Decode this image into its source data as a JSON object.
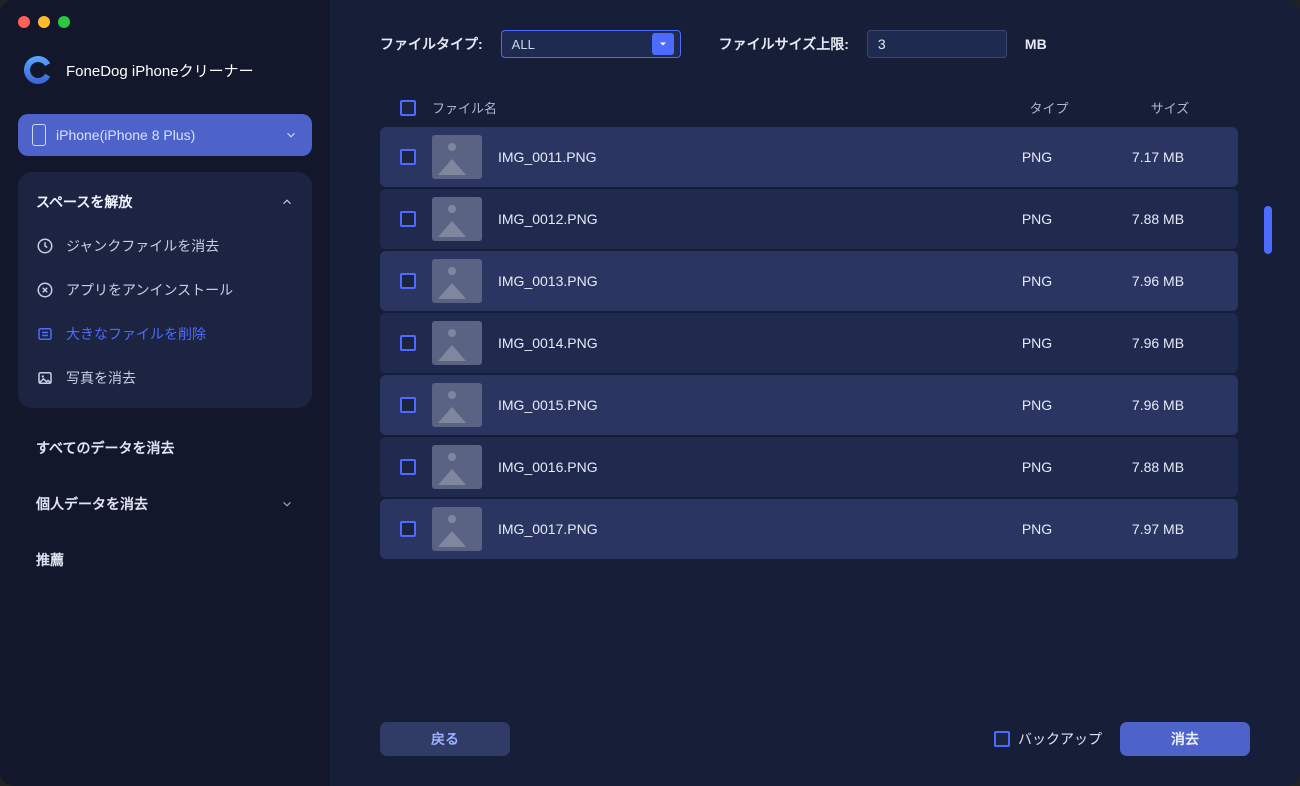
{
  "app_title": "FoneDog iPhoneクリーナー",
  "device": {
    "label": "iPhone(iPhone 8 Plus)"
  },
  "sidebar": {
    "free_space_header": "スペースを解放",
    "items": [
      {
        "label": "ジャンクファイルを消去",
        "icon": "clock-icon"
      },
      {
        "label": "アプリをアンインストール",
        "icon": "x-circle-icon"
      },
      {
        "label": "大きなファイルを削除",
        "icon": "list-icon",
        "active": true
      },
      {
        "label": "写真を消去",
        "icon": "photo-icon"
      }
    ],
    "erase_all": "すべてのデータを消去",
    "erase_private": "個人データを消去",
    "recommended": "推薦"
  },
  "filters": {
    "type_label": "ファイルタイプ:",
    "type_value": "ALL",
    "size_label": "ファイルサイズ上限:",
    "size_value": "3",
    "size_unit": "MB"
  },
  "table": {
    "header_name": "ファイル名",
    "header_type": "タイプ",
    "header_size": "サイズ",
    "rows": [
      {
        "name": "IMG_0011.PNG",
        "type": "PNG",
        "size": "7.17 MB"
      },
      {
        "name": "IMG_0012.PNG",
        "type": "PNG",
        "size": "7.88 MB"
      },
      {
        "name": "IMG_0013.PNG",
        "type": "PNG",
        "size": "7.96 MB"
      },
      {
        "name": "IMG_0014.PNG",
        "type": "PNG",
        "size": "7.96 MB"
      },
      {
        "name": "IMG_0015.PNG",
        "type": "PNG",
        "size": "7.96 MB"
      },
      {
        "name": "IMG_0016.PNG",
        "type": "PNG",
        "size": "7.88 MB"
      },
      {
        "name": "IMG_0017.PNG",
        "type": "PNG",
        "size": "7.97 MB"
      }
    ]
  },
  "footer": {
    "back": "戻る",
    "backup": "バックアップ",
    "erase": "消去"
  }
}
